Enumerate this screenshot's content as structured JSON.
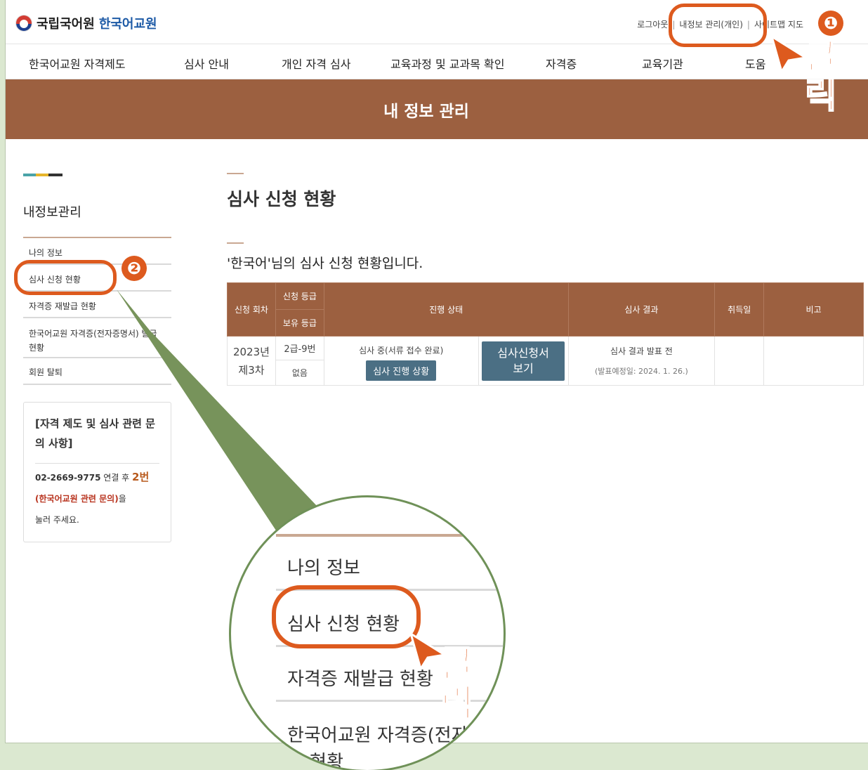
{
  "header": {
    "logo_text1": "국립국어원",
    "logo_text2": "한국어교원",
    "util": {
      "logout": "로그아웃",
      "my_info": "내정보 관리(개인)",
      "sitemap": "사이트맵 지도",
      "sep": "|"
    }
  },
  "gnb": [
    "한국어교원 자격제도",
    "심사 안내",
    "개인 자격 심사",
    "교육과정 및 교과목 확인",
    "자격증",
    "교육기관",
    "도움"
  ],
  "banner": {
    "title": "내 정보 관리"
  },
  "sidebar": {
    "title": "내정보관리",
    "items": [
      {
        "label": "나의 정보"
      },
      {
        "label": "심사 신청 현황"
      },
      {
        "label": "자격증 재발급 현황"
      },
      {
        "label": "한국어교원 자격증(전자증명서) 발급 현황"
      },
      {
        "label": "회원 탈퇴"
      }
    ],
    "contact": {
      "title": "[자격 제도 및 심사 관련 문의 사항]",
      "phone": "02-2669-9775",
      "after_phone": " 연결 후 ",
      "option": "2번",
      "category": "(한국어교원 관련 문의)",
      "after_category": "을",
      "press": "눌러 주세요."
    }
  },
  "main": {
    "title": "심사 신청 현황",
    "subtitle": "'한국어'님의 심사 신청 현황입니다.",
    "table": {
      "headers": {
        "round": "신청 회차",
        "grade_applied": "신청 등급",
        "grade_held": "보유 등급",
        "progress": "진행 상태",
        "result": "심사 결과",
        "acquired": "취득일",
        "note": "비고"
      },
      "row": {
        "year": "2023년",
        "round": "제3차",
        "grade_applied": "2급-9번",
        "grade_held": "없음",
        "progress_status": "심사 중(서류 접수 완료)",
        "progress_button": "심사 진행 상황",
        "view_button_line1": "심사신청서",
        "view_button_line2": "보기",
        "result": "심사 결과 발표 전",
        "result_date": "(발표예정일: 2024. 1. 26.)",
        "acquired": "",
        "note": ""
      }
    }
  },
  "annotations": {
    "step1": "❶",
    "step2": "❷",
    "click": "클릭",
    "accent": "#dd5a1e",
    "zoom_green": "#6f9158"
  },
  "zoom": {
    "items": [
      "나의 정보",
      "심사 신청 현황",
      "자격증 재발급 현황",
      "한국어교원 자격증(전자",
      "급 현황"
    ]
  }
}
